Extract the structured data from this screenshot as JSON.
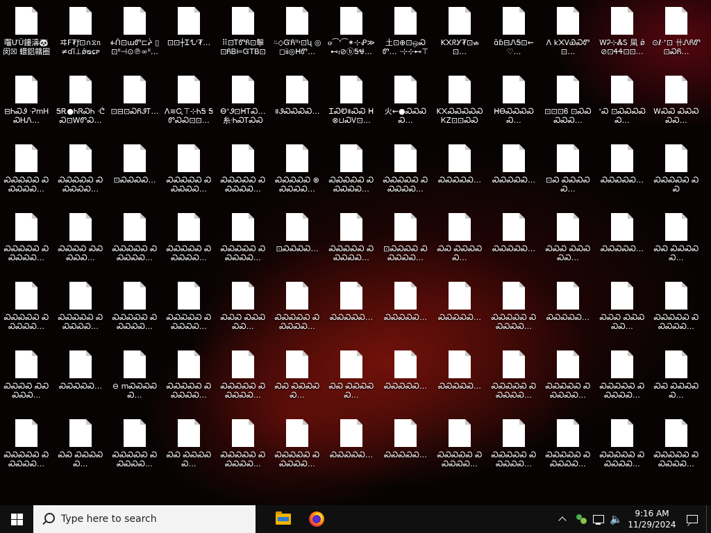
{
  "desktop": {
    "icons": [
      [
        "囓ƯÛ鏤濤🐼闵☒ 蠉鋁贛圈ⓓ饺⊠",
        "ヰF₮ƒ⊡∩⧖ᥰ ≠ɗĩ⊥ǿᴓɕᴩ⊜…",
        "ፉᑏ⊡ɯᏛ⊏ᖩ ▯⊡ᐦ⊣⊙℗∞ᐦ…",
        "⊡⊡┼Ꮖᖍᶤ₮…",
        "⠿⊡ᎢᏛᏲ⊡鬡 ⊡ᏲᏴ⊨ᏳᎢᏴ⊡⊡…",
        "⍨◇ᏳᏲᐦ᠈⊡ʯ ◎◻ᎥᎥ◎ᕼᏛ…",
        "ᏻ⁀ᐩ⁀✶⊹ᕵ≫ ⊷᎓⊘ⓑᎦᏠ…",
        "土⊡⊕⊡ஒᏍᏛ… ᐧ⊹⊹⊷⊤",
        "K᙭ᖇᎩ₮⊡ᏹ⊡…",
        "ɑ̃ɓ⊟ᏁᎦ⊡⇜♡…",
        "ᐱ k᙭ᏙᏯᏍᏛ⊡…",
        "ᎳᎮ⊹ᏜᏚ 凬 ǿ⊘⊡ᏎᏎ⊡⊡…",
        "⊙ℓᐧᐩ⊡ 卄ᏁᏲᏛ⊡ᏍᏲ…"
      ],
      [
        "⊟ᏂᏍᏭ ᐧᕈmᎻᏍᎻᏁ…",
        "ᎦᎡ●ᏂᏒᏍᏂ ᐧᕧᏍ⊡ᎳᏛᏍ…",
        "⊡⊟⊡ᏍᏲᏭᎢ… ",
        "ᐱ≋Ꮹ⊤⊹ᏂᎦ ᎦᏛᏍᏍ⊡⊡…",
        "ᎾᐩᏭ⊡ᕼᎢᏍ… 糸ᐧᏂᏍᎢᏍᏍ⊡…",
        "⩨ᏭᏍᏍᏍᏍ…",
        "ᏆᏍᏬ⩨ᏍᏍ ᕼ⊗⊔ᏍᏙ⊡…",
        "火⇜●ᏍᏍᏍᏍ…",
        "K᙭ᏍᏍᏍᏍᏍ ᏦᏃ⊡⊡ᏍᏍᏍ…",
        "ᕼᎾᏍᏍᏍᏍᏍ…",
        "⊡⊡⊡Ꮾ ⊡ᏍᏍᏍᏍᏍ…",
        "ᐩᏍ ⊡ᏍᏍᏍᏍᏍ…",
        "ᎳᏍᏍ ᏍᏍᏍᏍᏍ…"
      ],
      [
        "ᏍᏍᏍᏍᏍ ᏍᏍᏍᏍᏍ…",
        "ᏍᏍᏍᏍᏍ ᏍᏍᏍᏍᏍ…",
        "⊡ᏍᏍᏍᏍ…",
        "ᏍᏍᏍᏍᏍ ᏍᏍᏍᏍᏍ…",
        "ᏍᏍᏍᏍᏍ ᏍᏍᏍᏍᏍ…",
        "ᏍᏍᏍᏍᏍ ⊗ᏍᏍᏍᏍ…",
        "ᏍᏍᏍᏍᏍ ᏍᏍᏍᏍᏍ…",
        "ᏍᏍᏍᏍᏍ ᏍᏍᏍᏍᏍ…",
        "ᏍᏍᏍᏍᏍ…",
        "ᏍᏍᏍᏍᏍ…",
        "⊡Ꮝ ᏍᏍᏍᏍᏍ…",
        "ᏍᏍᏍᏍᏍ…",
        "ᏍᏍᏍᏍᏍ ᏍᏍ"
      ],
      [
        "ᏍᏍᏍᏍᏍ ᏍᏍᏍᏍᏍ…",
        "ᏍᏍᏍᏍ ᏍᏍᏍᏍᏍ…",
        "ᏍᏍᏍᏍᏍ ᏍᏍᏍᏍᏍ…",
        "ᏍᏍᏍᏍᏍ ᏍᏍᏍᏍᏍ…",
        "ᏍᏍᏍᏍᏍ ᏍᏍᏍᏍᏍ…",
        "⊡ᏍᏍᏍᏍ…",
        "ᏍᏍᏍᏍᏍ ᏍᏍᏍᏍᏍ…",
        "⊡ᏍᏍᏍᏍ ᏍᏍᏍᏍᏍ…",
        "ᏍᏍ ᏍᏍᏍᏍᏍ…",
        "ᏍᏍᏍᏍᏍ…",
        "ᏍᏍᏍ ᏍᏍᏍᏍᏍ…",
        "ᏍᏍᏍᏍᏍ…",
        "ᏍᏍ ᏍᏍᏍᏍᏍ…"
      ],
      [
        "ᏍᏍᏍᏍᏍ ᏍᏍᏍᏍᏍ…",
        "ᏍᏍᏍᏍᏍ ᏍᏍᏍᏍᏍ…",
        "ᏍᏍᏍᏍᏍ ᏍᏍᏍᏍᏍ…",
        "ᏍᏍᏍᏍᏍ ᏍᏍᏍᏍᏍ…",
        "ᏍᏍᏍ ᏍᏍᏍᏍᏍ…",
        "ᏍᏍᏍᏍᏍ ᏍᏍᏍᏍᏍ…",
        "ᏍᏍᏍᏍᏍ…",
        "ᏍᏍᏍᏍᏍ…",
        "ᏍᏍᏍᏍᏍ…",
        "ᏍᏍᏍᏍᏍ ᏍᏍᏍᏍᏍ…",
        "ᏍᏍᏍᏍᏍ…",
        "ᏍᏍᏍ ᏍᏍᏍᏍᏍ…",
        "ᏍᏍᏍᏍᏍ ᏍᏍᏍᏍᏍ…"
      ],
      [
        "ᏍᏍᏍᏍ ᏍᏍᏍᏍᏍ…",
        "ᏍᏍᏍᏍᏍ…",
        "⊖ mᏍᏍᏍᏍᏍ…",
        "ᏍᏍᏍᏍᏍ ᏍᏍᏍᏍᏍ…",
        "ᏍᏍᏍᏍᏍ ᏍᏍᏍᏍᏍ…",
        "ᏍᏍ ᏍᏍᏍᏍᏍ…",
        "ᏍᏍ ᏍᏍᏍᏍᏍ…",
        "ᏍᏍᏍᏍᏍ…",
        "ᏍᏍᏍᏍᏍ…",
        "ᏍᏍᏍᏍᏍ ᏍᏍᏍᏍᏍ…",
        "ᏍᏍᏍᏍᏍ ᏍᏍᏍᏍᏍ…",
        "ᏍᏍᏍᏍᏍ ᏍᏍᏍᏍᏍ…",
        "ᏍᏍ ᏍᏍᏍᏍᏍ…"
      ],
      [
        "ᏍᏍᏍᏍᏍ ᏍᏍᏍᏍᏍ…",
        "ᏍᏍ ᏍᏍᏍᏍᏍ…",
        "ᏍᏍᏍᏍᏍ ᏍᏍᏍᏍᏍ…",
        "ᏍᏍ ᏍᏍᏍᏍᏍ…",
        "ᏍᏍᏍᏍᏍ ᏍᏍᏍᏍᏍ…",
        "ᏍᏍᏍᏍᏍ ᏍᏍᏍᏍᏍ…",
        "ᏍᏍᏍᏍᏍ…",
        "ᏍᏍᏍᏍᏍ…",
        "ᏍᏍᏍᏍᏍ ᏍᏍᏍᏍᏍ…",
        "ᏍᏍᏍᏍᏍ ᏍᏍᏍᏍᏍ…",
        "ᏍᏍᏍᏍᏍ ᏍᏍᏍᏍᏍ…",
        "ᏍᏍᏍᏍᏍ ᏍᏍᏍᏍᏍ…",
        "ᏍᏍᏍᏍᏍ ᏍᏍᏍᏍᏍ…"
      ]
    ]
  },
  "taskbar": {
    "search_placeholder": "Type here to search",
    "apps": [
      "file-explorer",
      "firefox"
    ],
    "tray": {
      "volume_glyph": "🔈",
      "time": "9:16 AM",
      "date": "11/29/2024"
    }
  },
  "colors": {
    "taskbar": "#101010",
    "search_box": "#f3f3f3"
  }
}
